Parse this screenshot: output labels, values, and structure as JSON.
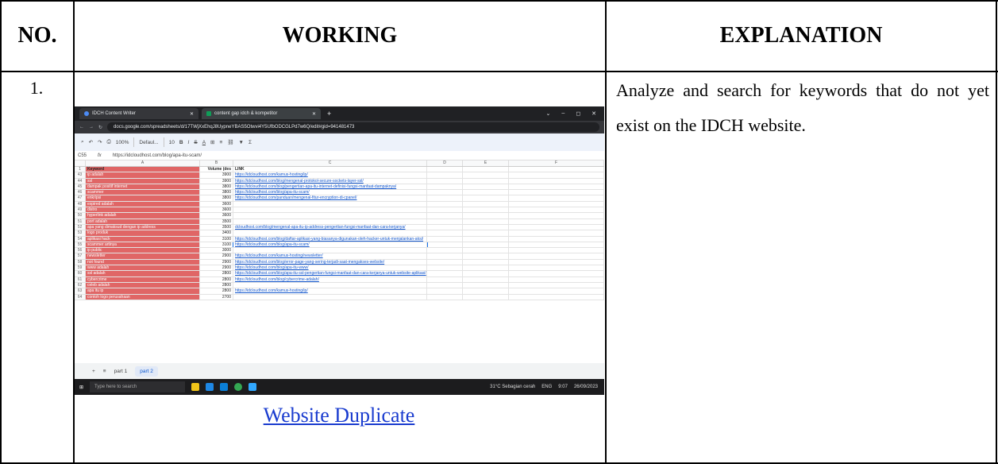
{
  "table": {
    "headers": {
      "no": "NO.",
      "working": "WORKING",
      "explanation": "EXPLANATION"
    },
    "row": {
      "no": "1.",
      "explanation": "Analyze and search for keywords that do not yet exist on the IDCH website.",
      "caption": "Website Duplicate"
    }
  },
  "screenshot": {
    "tabs": [
      "IDCH Content Writer",
      "content gap idch & kompetitor"
    ],
    "url": "docs.google.com/spreadsheets/d/17TWjXxEhqJ8UypneYBAS5Otwvi4Y5UfbODCGLPd7w6Q/edit#gid=941481473",
    "toolbar": [
      "100%",
      "Defaul...",
      "10"
    ],
    "cell_ref": "C55",
    "formula": "https://idcloudhost.com/blog/apa-itu-scam/",
    "columns": [
      "A",
      "B",
      "C",
      "D",
      "E",
      "F"
    ],
    "header_row": {
      "rn": "1",
      "keyword": "Keyword",
      "volume": "Volume (des",
      "link": "LINK"
    },
    "rows": [
      {
        "rn": "43",
        "kw": "ip adalah",
        "vol": "3900",
        "link": "https://idcloudhost.com/kamus-hosting/ip/"
      },
      {
        "rn": "44",
        "kw": "ssl",
        "vol": "3900",
        "link": "https://idcloudhost.com/blog/mengenal-protokol-secure-sockets-layer-ssl/"
      },
      {
        "rn": "45",
        "kw": "dampak positif internet",
        "vol": "3800",
        "link": "https://idcloudhost.com/blog/pengertian-apa-itu-internet-definisi-fungsi-manfaat-dampaknya/"
      },
      {
        "rn": "46",
        "kw": "scammer",
        "vol": "3800",
        "link": "https://idcloudhost.com/blog/apa-itu-scam/"
      },
      {
        "rn": "47",
        "kw": "enkripsi",
        "vol": "3800",
        "link": "https://idcloudhost.com/panduan/mengenal-fitur-encryption-di-cpanel/"
      },
      {
        "rn": "48",
        "kw": "expired adalah",
        "vol": "3600",
        "link": ""
      },
      {
        "rn": "49",
        "kw": "distro",
        "vol": "3600",
        "link": ""
      },
      {
        "rn": "50",
        "kw": "hyperlink adalah",
        "vol": "3600",
        "link": ""
      },
      {
        "rn": "51",
        "kw": "port adalah",
        "vol": "3500",
        "link": ""
      },
      {
        "rn": "52",
        "kw": "apa yang dimaksud dengan ip address",
        "vol": "3500",
        "link": "dcloudhost.com/blog/mengenal-apa-itu-ip-address-pengertian-fungsi-manfaat-dan-cara-kerjanya/"
      },
      {
        "rn": "53",
        "kw": "logo produk",
        "vol": "3400",
        "link": ""
      },
      {
        "rn": "54",
        "kw": "aplikasi hack",
        "vol": "3100",
        "link": "https://idcloudhost.com/blog/daftar-aplikasi-yang-biasanya-digunakan-oleh-hacker-untuk-menjalankan-aksi/"
      },
      {
        "rn": "55",
        "kw": "scammer artinya",
        "vol": "3100",
        "link": "https://idcloudhost.com/blog/apa-itu-scam/"
      },
      {
        "rn": "56",
        "kw": "ip public",
        "vol": "3000",
        "link": ""
      },
      {
        "rn": "57",
        "kw": "newsletter",
        "vol": "2900",
        "link": "https://idcloudhost.com/kamus-hosting/newsletter/"
      },
      {
        "rn": "58",
        "kw": "not found",
        "vol": "2900",
        "link": "https://idcloudhost.com/blog/error-page-yang-sering-terjadi-saat-mengakses-website/"
      },
      {
        "rn": "59",
        "kw": "www adalah",
        "vol": "2900",
        "link": "https://idcloudhost.com/blog/apa-itu-www/"
      },
      {
        "rn": "60",
        "kw": "ssl adalah",
        "vol": "2800",
        "link": "https://idcloudhost.com/blog/apa-itu-ssl-pengertian-fungsi-manfaat-dan-cara-kerjanya-untuk-website-aplikasi/"
      },
      {
        "rn": "61",
        "kw": "cybercrime",
        "vol": "2800",
        "link": "https://idcloudhost.com/blog/cybercrime-adalah/"
      },
      {
        "rn": "62",
        "kw": "celeb adalah",
        "vol": "2800",
        "link": ""
      },
      {
        "rn": "63",
        "kw": "apa itu ip",
        "vol": "2800",
        "link": "https://idcloudhost.com/kamus-hosting/ip/"
      },
      {
        "rn": "64",
        "kw": "contoh logo perusahaan",
        "vol": "2700",
        "link": ""
      }
    ],
    "sheets": [
      "part 1",
      "part 2"
    ],
    "taskbar": {
      "search": "Type here to search",
      "weather": "31°C  Sebagian cerah",
      "lang": "ENG",
      "time": "9:07",
      "date": "26/09/2023"
    }
  }
}
